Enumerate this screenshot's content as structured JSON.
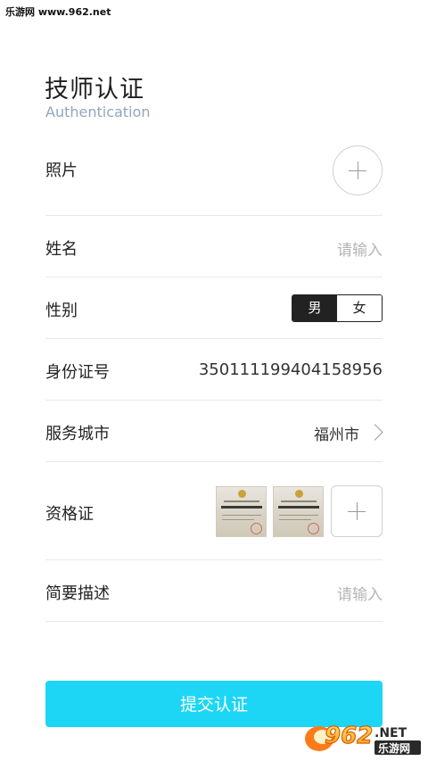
{
  "watermark": "乐游网 www.962.net",
  "header": {
    "title": "技师认证",
    "subtitle": "Authentication"
  },
  "form": {
    "photo": {
      "label": "照片",
      "icon": "plus-icon"
    },
    "name": {
      "label": "姓名",
      "placeholder": "请输入"
    },
    "gender": {
      "label": "性别",
      "options": [
        "男",
        "女"
      ],
      "selected": "男"
    },
    "id_number": {
      "label": "身份证号",
      "value": "350111199404158956"
    },
    "city": {
      "label": "服务城市",
      "value": "福州市",
      "icon": "chevron-right-icon"
    },
    "certificate": {
      "label": "资格证",
      "thumbnail_count": 2,
      "icon": "plus-icon"
    },
    "description": {
      "label": "简要描述",
      "placeholder": "请输入"
    }
  },
  "submit_label": "提交认证",
  "logo": {
    "main": "962",
    "suffix": ".NET",
    "sub": "乐游网"
  },
  "colors": {
    "accent": "#1dd6f5",
    "subtitle": "#8fa6bf",
    "placeholder": "#b5b5b5"
  }
}
